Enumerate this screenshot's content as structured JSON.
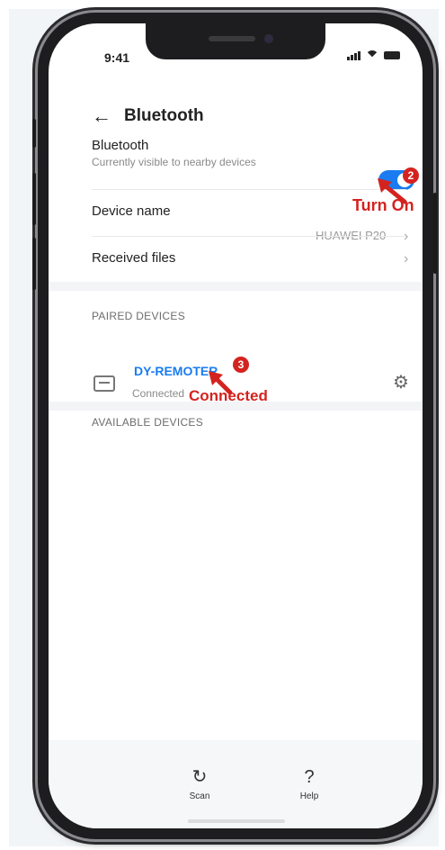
{
  "status_bar": {
    "time": "9:41"
  },
  "header": {
    "title": "Bluetooth"
  },
  "bluetooth_row": {
    "label": "Bluetooth",
    "sublabel": "Currently visible to nearby devices",
    "toggle_on": true
  },
  "device_name_row": {
    "label": "Device name",
    "value": "HUAWEI P20"
  },
  "received_files_row": {
    "label": "Received files"
  },
  "paired_section": {
    "title": "PAIRED DEVICES",
    "devices": [
      {
        "name": "DY-REMOTER",
        "status": "Connected"
      }
    ]
  },
  "available_section": {
    "title": "AVAILABLE DEVICES"
  },
  "annotations": {
    "step2": {
      "number": "2",
      "text": "Turn On"
    },
    "step3": {
      "number": "3",
      "text": "Connected"
    },
    "color": "#d4231f"
  },
  "bottom_bar": {
    "scan_label": "Scan",
    "help_label": "Help"
  },
  "colors": {
    "accent": "#1a7cf0"
  }
}
